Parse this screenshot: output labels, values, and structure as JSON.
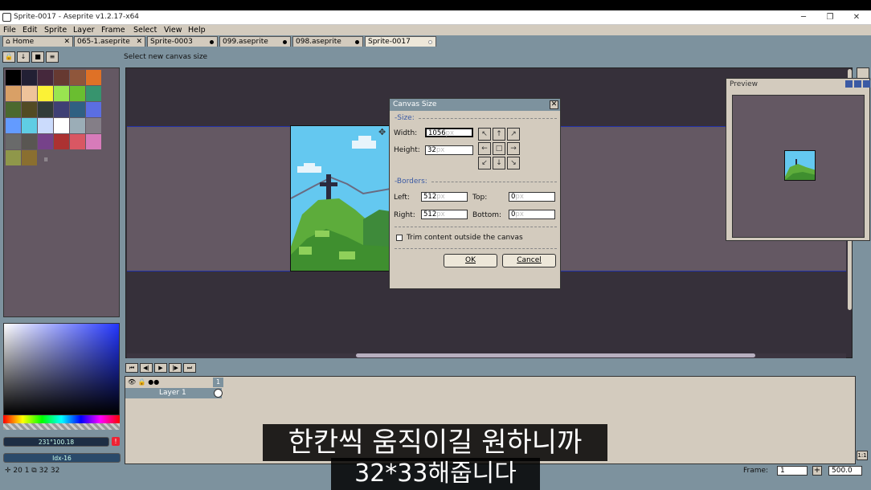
{
  "window": {
    "title": "Sprite-0017 - Aseprite v1.2.17-x64",
    "minimize": "─",
    "maximize": "❐",
    "close": "✕"
  },
  "menu": [
    "File",
    "Edit",
    "Sprite",
    "Layer",
    "Frame",
    "Select",
    "View",
    "Help"
  ],
  "tabs": [
    {
      "label": "Home",
      "marker": "✕"
    },
    {
      "label": "065-1.aseprite",
      "marker": "✕"
    },
    {
      "label": "Sprite-0003",
      "marker": "dot"
    },
    {
      "label": "099.aseprite",
      "marker": "dot"
    },
    {
      "label": "098.aseprite",
      "marker": "dot"
    },
    {
      "label": "Sprite-0017",
      "marker": "dot",
      "active": true
    }
  ],
  "toolbar": {
    "status": "Select new canvas size"
  },
  "palette": {
    "colors": [
      "#000000",
      "#222034",
      "#45283c",
      "#663931",
      "#8f563b",
      "#df7126",
      "#d9a066",
      "#eec39a",
      "#fbf236",
      "#99e550",
      "#6abe30",
      "#37946e",
      "#4b692f",
      "#524b24",
      "#323c39",
      "#3f3f74",
      "#306082",
      "#5b6ee1",
      "#639bff",
      "#5fcde4",
      "#cbdbfc",
      "#ffffff",
      "#9badb7",
      "#847e87",
      "#696a6a",
      "#595652",
      "#76428a",
      "#ac3232",
      "#d95763",
      "#d77bba",
      "#8f974a",
      "#8a6f30"
    ],
    "extra": "II"
  },
  "color_fields": {
    "rgb": "231°100.18",
    "index": "Idx-16",
    "warning": "!"
  },
  "footer_left": "✛ 20 1 ⧉ 32 32",
  "preview": {
    "title": "Preview"
  },
  "dialog": {
    "title": "Canvas Size",
    "size_section": "-Size:",
    "width_label": "Width:",
    "width_value": "1056",
    "height_label": "Height:",
    "height_value": "32",
    "unit": "px",
    "anchors": [
      "↖",
      "↑",
      "↗",
      "←",
      "□",
      "→",
      "↙",
      "↓",
      "↘"
    ],
    "borders_section": "-Borders:",
    "left_label": "Left:",
    "left_value": "512",
    "top_label": "Top:",
    "top_value": "0",
    "right_label": "Right:",
    "right_value": "512",
    "bottom_label": "Bottom:",
    "bottom_value": "0",
    "trim_label": "Trim content outside the canvas",
    "ok": "OK",
    "cancel": "Cancel"
  },
  "timeline": {
    "frame_header": "1",
    "layer_name": "Layer 1",
    "playback": [
      "⏮",
      "◀|",
      "▶",
      "|▶",
      "⏭"
    ]
  },
  "footer_right": {
    "frame_label": "Frame:",
    "frame_value": "1",
    "plus": "+",
    "zoom": "500.0",
    "ratio": "1:1"
  },
  "subtitles": {
    "line1": "한칸씩 움직이길 원하니까",
    "line2": "32*33해줍니다"
  }
}
